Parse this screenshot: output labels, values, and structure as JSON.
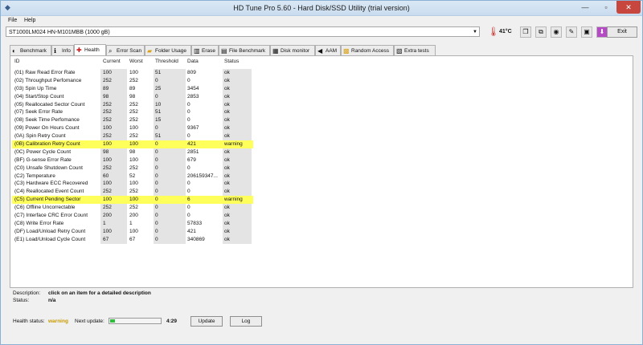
{
  "window": {
    "title": "HD Tune Pro 5.60 - Hard Disk/SSD Utility (trial version)"
  },
  "menu": {
    "file": "File",
    "help": "Help"
  },
  "toolbar": {
    "drive": "ST1000LM024 HN-M101MBB (1000 gB)",
    "temperature": "41°C",
    "exit": "Exit"
  },
  "tabs": [
    "Benchmark",
    "Info",
    "Health",
    "Error Scan",
    "Folder Usage",
    "Erase",
    "File Benchmark",
    "Disk monitor",
    "AAM",
    "Random Access",
    "Extra tests"
  ],
  "columns": {
    "id": "ID",
    "current": "Current",
    "worst": "Worst",
    "threshold": "Threshold",
    "data": "Data",
    "status": "Status"
  },
  "rows": [
    {
      "id": "(01) Raw Read Error Rate",
      "current": "100",
      "worst": "100",
      "threshold": "51",
      "data": "809",
      "status": "ok"
    },
    {
      "id": "(02) Throughput Perfomance",
      "current": "252",
      "worst": "252",
      "threshold": "0",
      "data": "0",
      "status": "ok"
    },
    {
      "id": "(03) Spin Up Time",
      "current": "89",
      "worst": "89",
      "threshold": "25",
      "data": "3454",
      "status": "ok"
    },
    {
      "id": "(04) Start/Stop Count",
      "current": "98",
      "worst": "98",
      "threshold": "0",
      "data": "2853",
      "status": "ok"
    },
    {
      "id": "(05) Reallocated Sector Count",
      "current": "252",
      "worst": "252",
      "threshold": "10",
      "data": "0",
      "status": "ok"
    },
    {
      "id": "(07) Seek Error Rate",
      "current": "252",
      "worst": "252",
      "threshold": "51",
      "data": "0",
      "status": "ok"
    },
    {
      "id": "(08) Seek Time Perfomance",
      "current": "252",
      "worst": "252",
      "threshold": "15",
      "data": "0",
      "status": "ok"
    },
    {
      "id": "(09) Power On Hours Count",
      "current": "100",
      "worst": "100",
      "threshold": "0",
      "data": "9367",
      "status": "ok"
    },
    {
      "id": "(0A) Spin Retry Count",
      "current": "252",
      "worst": "252",
      "threshold": "51",
      "data": "0",
      "status": "ok"
    },
    {
      "id": "(0B) Calibration Retry Count",
      "current": "100",
      "worst": "100",
      "threshold": "0",
      "data": "421",
      "status": "warning"
    },
    {
      "id": "(0C) Power Cycle Count",
      "current": "98",
      "worst": "98",
      "threshold": "0",
      "data": "2851",
      "status": "ok"
    },
    {
      "id": "(BF) G-sense Error Rate",
      "current": "100",
      "worst": "100",
      "threshold": "0",
      "data": "679",
      "status": "ok"
    },
    {
      "id": "(C0) Unsafe Shutdown Count",
      "current": "252",
      "worst": "252",
      "threshold": "0",
      "data": "0",
      "status": "ok"
    },
    {
      "id": "(C2) Temperature",
      "current": "60",
      "worst": "52",
      "threshold": "0",
      "data": "206159347...",
      "status": "ok"
    },
    {
      "id": "(C3) Hardware ECC Recovered",
      "current": "100",
      "worst": "100",
      "threshold": "0",
      "data": "0",
      "status": "ok"
    },
    {
      "id": "(C4) Reallocated Event Count",
      "current": "252",
      "worst": "252",
      "threshold": "0",
      "data": "0",
      "status": "ok"
    },
    {
      "id": "(C5) Current Pending Sector",
      "current": "100",
      "worst": "100",
      "threshold": "0",
      "data": "6",
      "status": "warning"
    },
    {
      "id": "(C6) Offline Uncorrectable",
      "current": "252",
      "worst": "252",
      "threshold": "0",
      "data": "0",
      "status": "ok"
    },
    {
      "id": "(C7) Interface CRC Error Count",
      "current": "200",
      "worst": "200",
      "threshold": "0",
      "data": "0",
      "status": "ok"
    },
    {
      "id": "(C8) Write Error Rate",
      "current": "1",
      "worst": "1",
      "threshold": "0",
      "data": "57833",
      "status": "ok"
    },
    {
      "id": "(DF) Load/Unload Retry Count",
      "current": "100",
      "worst": "100",
      "threshold": "0",
      "data": "421",
      "status": "ok"
    },
    {
      "id": "(E1) Load/Unload Cycle Count",
      "current": "67",
      "worst": "67",
      "threshold": "0",
      "data": "340869",
      "status": "ok"
    }
  ],
  "description": {
    "label": "Description:",
    "value": "click on an item for a detailed description",
    "status_label": "Status:",
    "status_value": "n/a"
  },
  "statusbar": {
    "health_label": "Health status:",
    "health_value": "warning",
    "next_update_label": "Next update:",
    "countdown": "4:29",
    "progress": 0.1,
    "update": "Update",
    "log": "Log"
  },
  "colors": {
    "warning_row": "#ffff5c",
    "health_warning": "#c99a00",
    "progress": "#2bbf3a"
  }
}
